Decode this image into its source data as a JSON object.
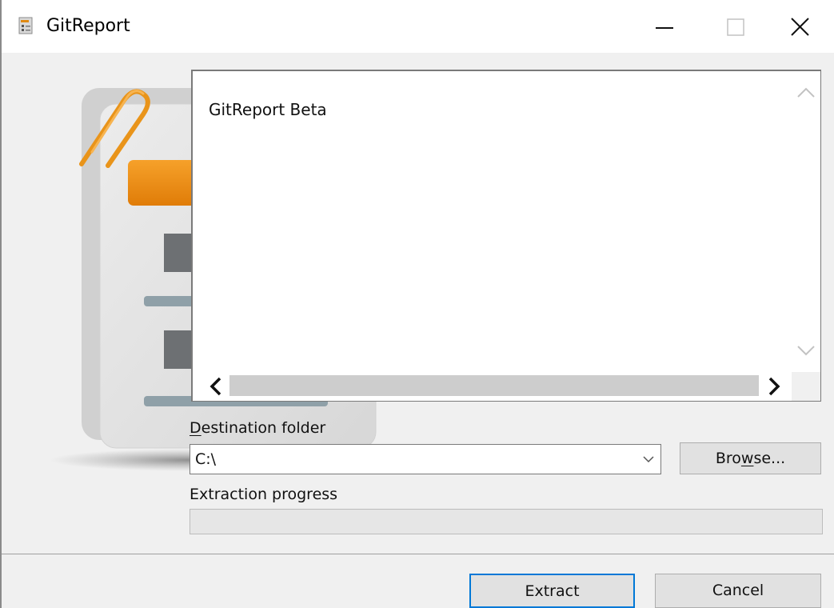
{
  "window": {
    "title": "GitReport",
    "controls": {
      "minimize_icon": "minimize-icon",
      "maximize_icon": "maximize-icon",
      "close_icon": "close-icon"
    }
  },
  "readme": {
    "text": "GitReport Beta"
  },
  "destination": {
    "label_prefix": "",
    "label_mnemonic": "D",
    "label_rest": "estination folder",
    "value": "C:\\",
    "browse_pre": "Bro",
    "browse_mnemonic": "w",
    "browse_post": "se..."
  },
  "progress": {
    "label": "Extraction progress",
    "fraction": 0
  },
  "buttons": {
    "extract": "Extract",
    "cancel": "Cancel"
  },
  "colors": {
    "accent": "#0078d7",
    "illustration_orange": "#ef8f12",
    "progress_green": "#06b025"
  }
}
